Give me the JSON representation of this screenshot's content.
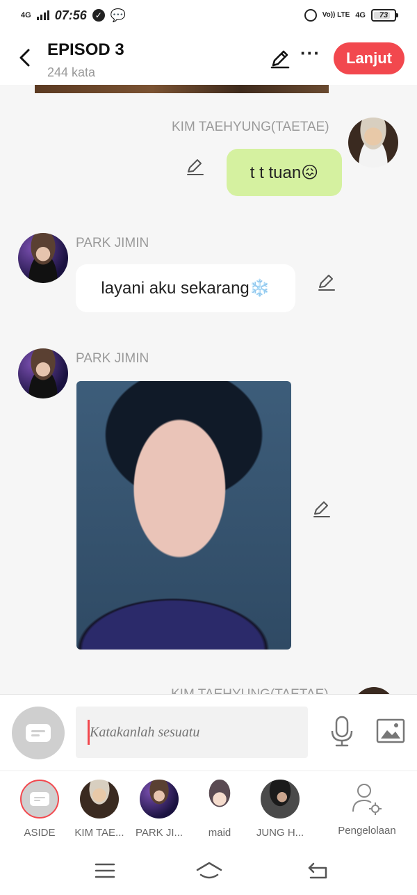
{
  "status_bar": {
    "network": "4G",
    "time": "07:56",
    "volte": "Vo)) LTE",
    "network_right": "4G",
    "battery": "73"
  },
  "header": {
    "title": "EPISOD 3",
    "word_count": "244 kata",
    "next_label": "Lanjut"
  },
  "messages": [
    {
      "sender": "KIM TAEHYUNG(TAETAE)",
      "text": "t t tuan😖",
      "side": "right"
    },
    {
      "sender": "PARK JIMIN",
      "text": "layani aku sekarang❄️",
      "side": "left"
    },
    {
      "sender": "PARK JIMIN",
      "type": "image",
      "side": "left"
    },
    {
      "sender": "KIM TAEHYUNG(TAETAE)",
      "side": "right"
    }
  ],
  "input": {
    "placeholder": "Katakanlah sesuatu"
  },
  "characters": [
    {
      "label": "ASIDE"
    },
    {
      "label": "KIM TAE..."
    },
    {
      "label": "PARK JI..."
    },
    {
      "label": "maid"
    },
    {
      "label": "JUNG H..."
    },
    {
      "label": "Pengelolaan"
    }
  ],
  "colors": {
    "accent": "#f2484e",
    "bubble_green": "#d5f1a0",
    "bubble_white": "#ffffff"
  }
}
